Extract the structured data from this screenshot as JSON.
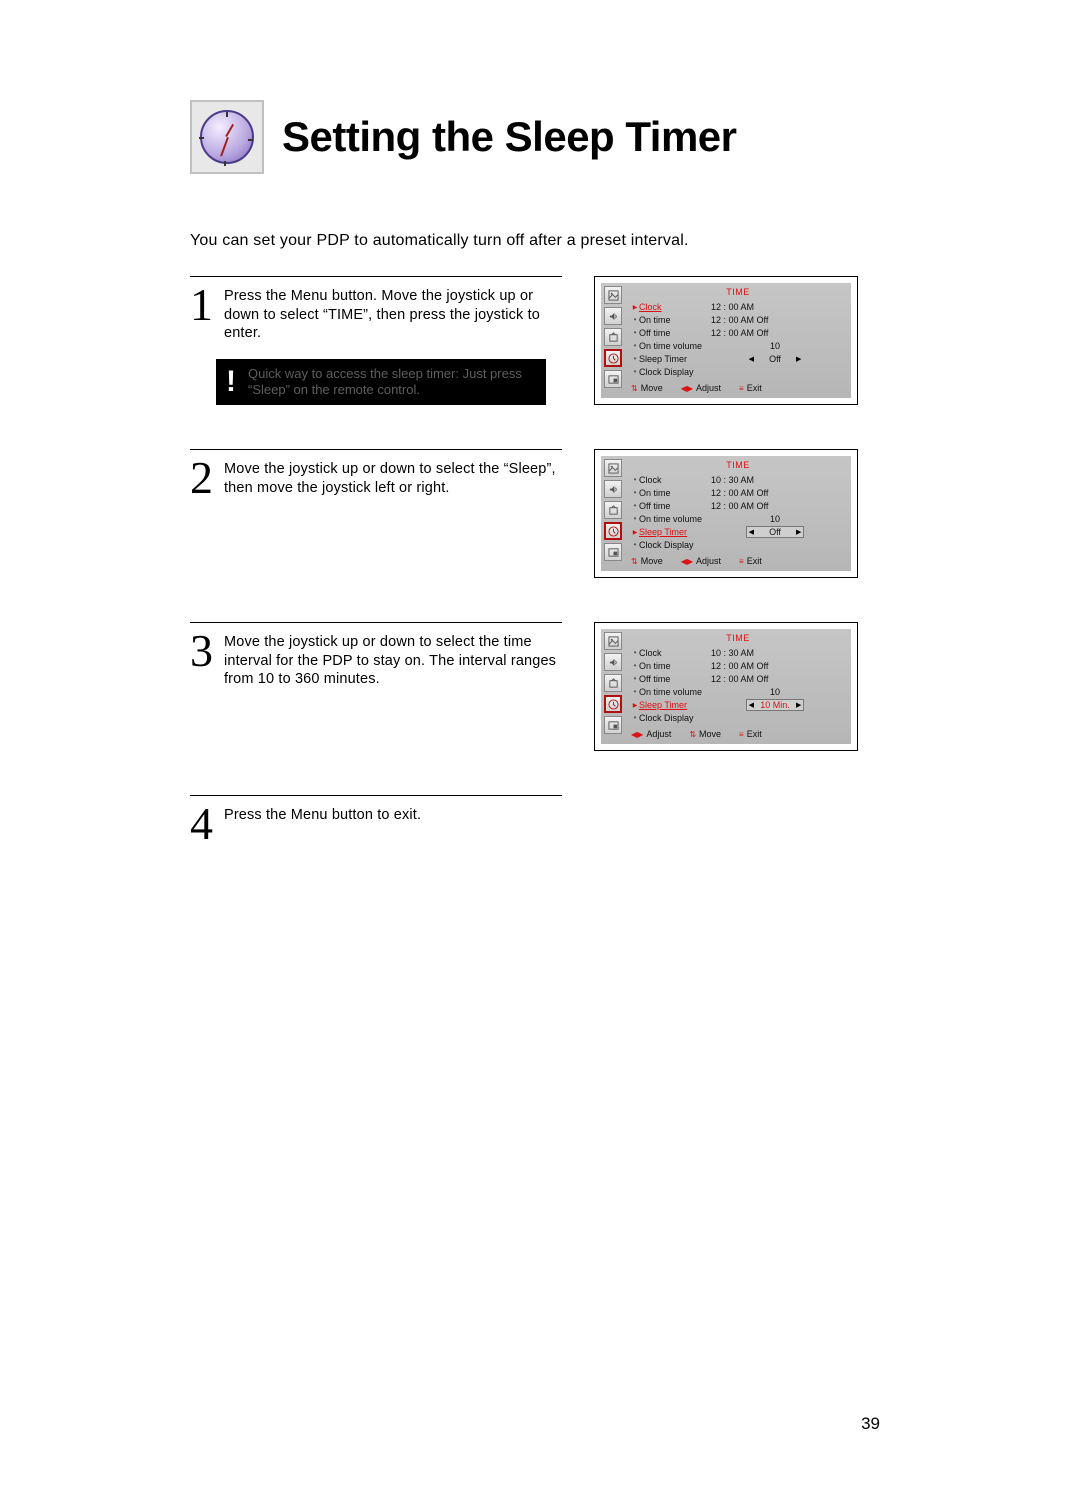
{
  "title": "Setting the Sleep Timer",
  "intro": "You can set your PDP to automatically turn off after a preset interval.",
  "page_number": "39",
  "steps": [
    {
      "num": "1",
      "text": "Press the Menu button. Move the joystick up or down to select “TIME”, then press the joystick to enter.",
      "note": "Quick way to access the sleep timer: Just press “Sleep” on the remote control."
    },
    {
      "num": "2",
      "text": "Move the joystick up or down to select the “Sleep”, then move the joystick left or right."
    },
    {
      "num": "3",
      "text": "Move the joystick up or down to select the time interval for the PDP to stay on.  The interval ranges from 10 to 360 minutes."
    },
    {
      "num": "4",
      "text": "Press the Menu button to exit."
    }
  ],
  "osd": {
    "title": "TIME",
    "rows_labels": {
      "clock": "Clock",
      "on_time": "On time",
      "off_time": "Off time",
      "on_time_volume": "On time volume",
      "sleep_timer": "Sleep Timer",
      "clock_display": "Clock Display"
    },
    "foot": {
      "move": "Move",
      "adjust": "Adjust",
      "exit": "Exit"
    },
    "screens": [
      {
        "selected": "clock",
        "clock_value": "12 : 00  AM",
        "on_time": "12 : 00  AM  Off",
        "off_time": "12 : 00  AM  Off",
        "on_time_volume": "10",
        "sleep_timer": "Off",
        "sleep_boxed": false,
        "sleep_hl": false,
        "foot_order": [
          "move",
          "adjust",
          "exit"
        ]
      },
      {
        "selected": "sleep_timer",
        "clock_value": "10 : 30  AM",
        "on_time": "12 : 00  AM  Off",
        "off_time": "12 : 00  AM  Off",
        "on_time_volume": "10",
        "sleep_timer": "Off",
        "sleep_boxed": true,
        "sleep_hl": false,
        "foot_order": [
          "move",
          "adjust",
          "exit"
        ]
      },
      {
        "selected": "sleep_timer",
        "clock_value": "10 : 30  AM",
        "on_time": "12 : 00  AM  Off",
        "off_time": "12 : 00  AM  Off",
        "on_time_volume": "10",
        "sleep_timer": "10 Min.",
        "sleep_boxed": true,
        "sleep_hl": true,
        "foot_order": [
          "adjust",
          "move",
          "exit"
        ]
      }
    ]
  }
}
